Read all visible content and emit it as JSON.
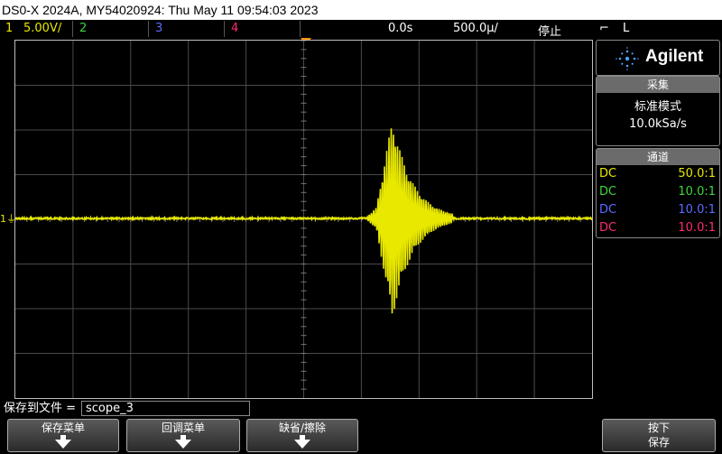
{
  "window": {
    "title": "DS0-X 2024A, MY54020924: Thu May 11 09:54:03 2023"
  },
  "status": {
    "ch1_num": "1",
    "ch1_scale": "5.00V/",
    "ch2_num": "2",
    "ch3_num": "3",
    "ch4_num": "4",
    "time_offset": "0.0s",
    "time_scale": "500.0µ/",
    "run_state": "停止",
    "trigger_slope": "ℂ",
    "trigger_level": "L"
  },
  "brand": {
    "name": "Agilent"
  },
  "acquisition": {
    "header": "采集",
    "mode": "标准模式",
    "rate": "10.0kSa/s"
  },
  "channels": {
    "header": "通道",
    "rows": [
      {
        "coupling": "DC",
        "probe": "50.0:1",
        "color": "#e8e800"
      },
      {
        "coupling": "DC",
        "probe": "10.0:1",
        "color": "#3ed63e"
      },
      {
        "coupling": "DC",
        "probe": "10.0:1",
        "color": "#5b6cff"
      },
      {
        "coupling": "DC",
        "probe": "10.0:1",
        "color": "#ff2b6e"
      }
    ]
  },
  "save": {
    "label": "保存到文件 =",
    "filename": "scope_3"
  },
  "softkeys": {
    "save_menu": "保存菜单",
    "recall_menu": "回调菜单",
    "defaults_erase": "缺省/擦除",
    "press_line1": "按下",
    "press_line2": "保存"
  },
  "colors": {
    "ch1": "#e8e800",
    "ch2": "#3ed63e",
    "ch3": "#5b6cff",
    "ch4": "#ff2b6e",
    "trigger_marker": "#ff8c00"
  }
}
